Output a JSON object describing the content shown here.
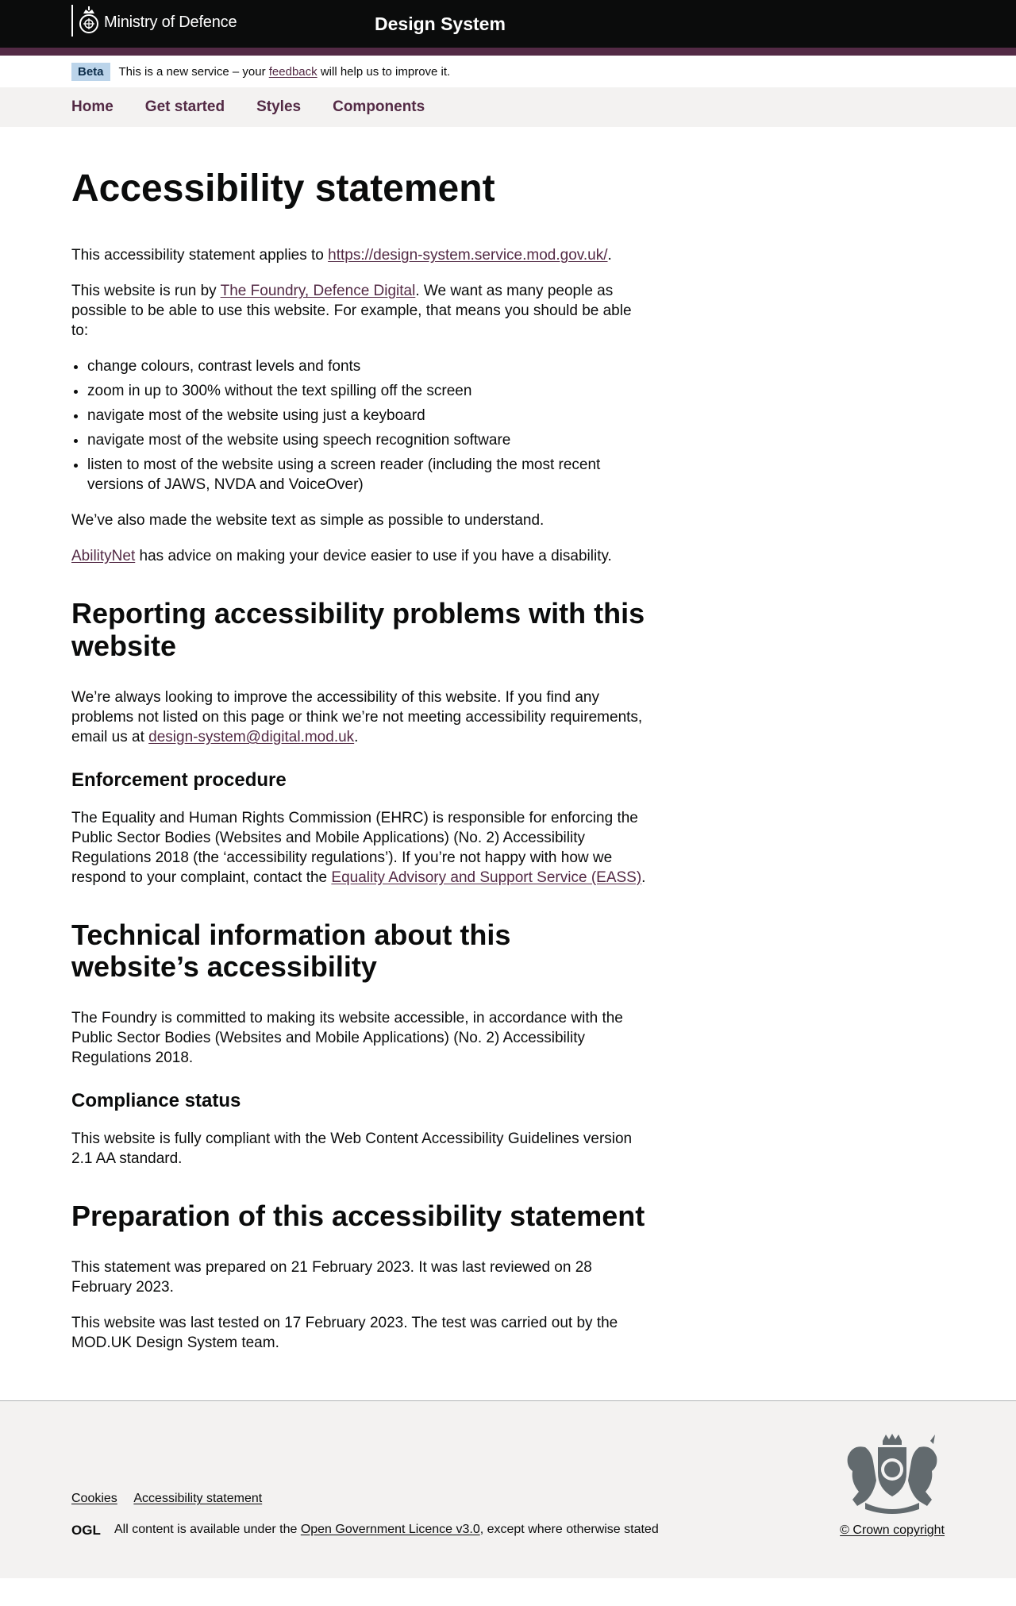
{
  "header": {
    "org_name": "Ministry of Defence",
    "service_name": "Design System",
    "crest_icon": "mod-crest-icon"
  },
  "phase_banner": {
    "tag": "Beta",
    "text_before": "This is a new service – your ",
    "link": "feedback",
    "text_after": " will help us to improve it."
  },
  "nav": {
    "items": [
      {
        "label": "Home"
      },
      {
        "label": "Get started"
      },
      {
        "label": "Styles"
      },
      {
        "label": "Components"
      }
    ]
  },
  "main": {
    "title": "Accessibility statement",
    "intro": {
      "p1_before": "This accessibility statement applies to ",
      "p1_link": "https://design-system.service.mod.gov.uk/",
      "p1_after": ".",
      "p2_before": "This website is run by ",
      "p2_link": "The Foundry, Defence Digital",
      "p2_after": ". We want as many people as possible to be able to use this website. For example, that means you should be able to:",
      "list": [
        "change colours, contrast levels and fonts",
        "zoom in up to 300% without the text spilling off the screen",
        "navigate most of the website using just a keyboard",
        "navigate most of the website using speech recognition software",
        "listen to most of the website using a screen reader (including the most recent versions of JAWS, NVDA and VoiceOver)"
      ],
      "p3": "We’ve also made the website text as simple as possible to understand.",
      "p4_link": "AbilityNet",
      "p4_after": " has advice on making your device easier to use if you have a disability."
    },
    "reporting": {
      "heading": "Reporting accessibility problems with this website",
      "p_before": "We’re always looking to improve the accessibility of this website. If you find any problems not listed on this page or think we’re not meeting accessibility requirements, email us at ",
      "p_link": "design-system@digital.mod.uk",
      "p_after": "."
    },
    "enforcement": {
      "heading": "Enforcement procedure",
      "p_before": "The Equality and Human Rights Commission (EHRC) is responsible for enforcing the Public Sector Bodies (Websites and Mobile Applications) (No. 2) Accessibility Regulations 2018 (the ‘accessibility regulations’). If you’re not happy with how we respond to your complaint, contact the ",
      "p_link": "Equality Advisory and Support Service (EASS)",
      "p_after": "."
    },
    "technical": {
      "heading": "Technical information about this website’s accessibility",
      "p": "The Foundry is committed to making its website accessible, in accordance with the Public Sector Bodies (Websites and Mobile Applications) (No. 2) Accessibility Regulations 2018."
    },
    "compliance": {
      "heading": "Compliance status",
      "p": "This website is fully compliant with the Web Content Accessibility Guidelines version 2.1 AA standard."
    },
    "preparation": {
      "heading": "Preparation of this accessibility statement",
      "p1": "This statement was prepared on 21 February 2023. It was last reviewed on 28 February 2023.",
      "p2": "This website was last tested on 17 February 2023. The test was carried out by the MOD.UK Design System team."
    }
  },
  "footer": {
    "links": [
      {
        "label": "Cookies"
      },
      {
        "label": "Accessibility statement"
      }
    ],
    "ogl_label": "OGL",
    "licence_before": "All content is available under the ",
    "licence_link": "Open Government Licence v3.0",
    "licence_after": ", except where otherwise stated",
    "copyright": "© Crown copyright",
    "crest_icon": "royal-coat-of-arms-icon"
  }
}
